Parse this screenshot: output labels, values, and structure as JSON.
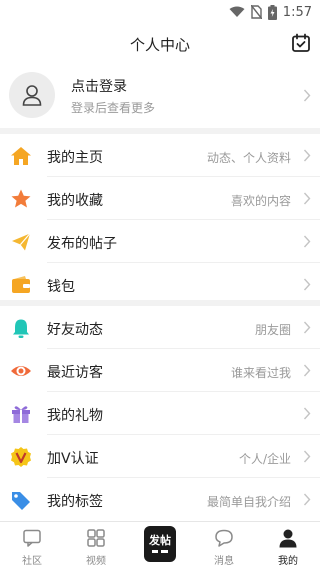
{
  "status_bar": {
    "time": "1:57",
    "icons": [
      "wifi-icon",
      "no-sim-icon",
      "battery-charging-icon"
    ]
  },
  "header": {
    "title": "个人中心",
    "right_icon": "calendar-check-icon"
  },
  "profile": {
    "avatar_icon": "user-avatar-icon",
    "title": "点击登录",
    "subtitle": "登录后查看更多"
  },
  "menu": {
    "group1": [
      {
        "icon": "home-icon",
        "label": "我的主页",
        "hint": "动态、个人资料",
        "color": "#f5a623"
      },
      {
        "icon": "star-icon",
        "label": "我的收藏",
        "hint": "喜欢的内容",
        "color": "#f27c3a"
      },
      {
        "icon": "paper-plane-icon",
        "label": "发布的帖子",
        "hint": "",
        "color": "#f5b731"
      },
      {
        "icon": "wallet-icon",
        "label": "钱包",
        "hint": "",
        "color": "#f5a623"
      }
    ],
    "group2": [
      {
        "icon": "bell-icon",
        "label": "好友动态",
        "hint": "朋友圈",
        "color": "#21c6b7"
      },
      {
        "icon": "eye-icon",
        "label": "最近访客",
        "hint": "谁来看过我",
        "color": "#f06a3a"
      },
      {
        "icon": "gift-icon",
        "label": "我的礼物",
        "hint": "",
        "color": "#8e6bd8"
      },
      {
        "icon": "v-badge-icon",
        "label": "加V认证",
        "hint": "个人/企业",
        "color": "#f5c518"
      },
      {
        "icon": "tag-icon",
        "label": "我的标签",
        "hint": "最简单自我介绍",
        "color": "#3a8ee6"
      }
    ]
  },
  "tabbar": {
    "tabs": [
      {
        "icon": "community-icon",
        "label": "社区",
        "active": false
      },
      {
        "icon": "video-grid-icon",
        "label": "视频",
        "active": false
      },
      {
        "icon": "chat-bubble-icon",
        "label": "消息",
        "active": false
      },
      {
        "icon": "person-icon",
        "label": "我的",
        "active": true
      }
    ],
    "post_button": "发帖"
  }
}
